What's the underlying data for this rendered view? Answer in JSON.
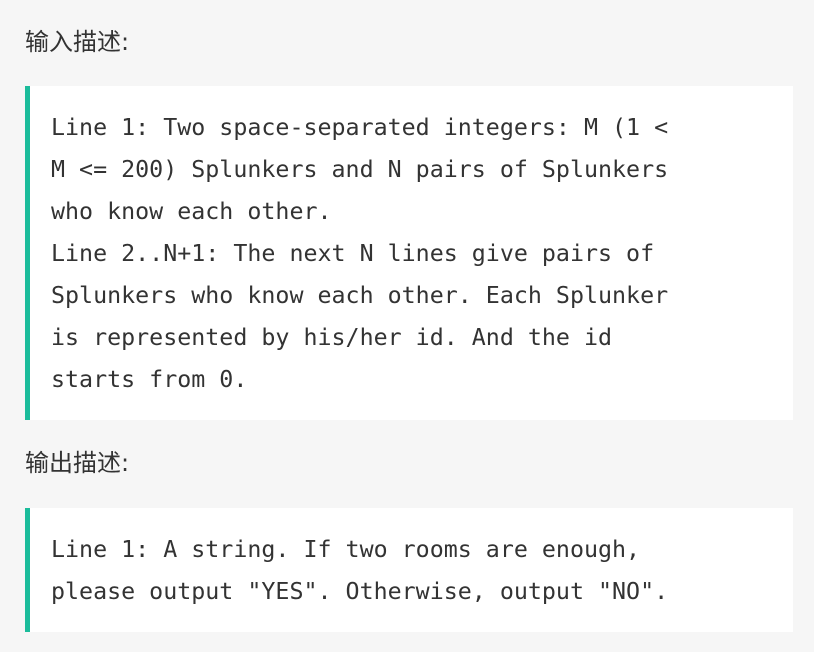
{
  "input_section": {
    "heading": "输入描述:",
    "lines": [
      "Line 1: Two space-separated integers: M (1 <",
      "M <= 200) Splunkers and N pairs of Splunkers",
      "who know each other.",
      "Line 2..N+1: The next N lines give pairs of",
      "Splunkers who know each other. Each Splunker",
      "is represented by his/her id. And the id",
      "starts from 0."
    ]
  },
  "output_section": {
    "heading": "输出描述:",
    "lines": [
      "Line 1: A string. If two rooms are enough,",
      "please output \"YES\". Otherwise, output \"NO\"."
    ]
  },
  "colors": {
    "page_background": "#f6f6f6",
    "block_background": "#ffffff",
    "accent_border": "#1bbc9b",
    "text": "#333333"
  }
}
